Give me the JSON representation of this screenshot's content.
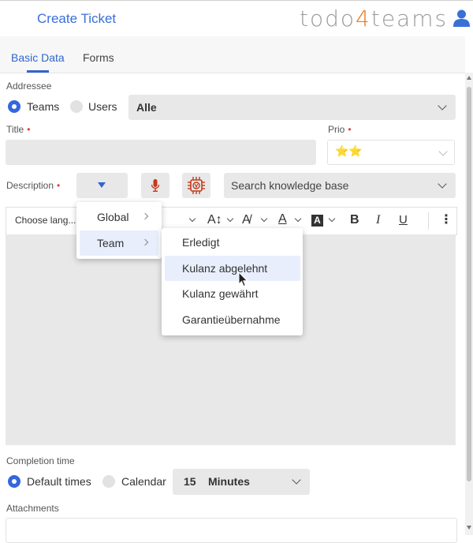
{
  "header": {
    "title": "Create Ticket",
    "logo_prefix": "todo",
    "logo_digit": "4",
    "logo_suffix": "teams",
    "accent_color": "#3a6fd8",
    "logo_digit_color": "#e87b1d"
  },
  "tabs": [
    {
      "label": "Basic Data",
      "active": true
    },
    {
      "label": "Forms",
      "active": false
    }
  ],
  "addressee": {
    "label": "Addressee",
    "options": [
      {
        "label": "Teams",
        "selected": true
      },
      {
        "label": "Users",
        "selected": false
      }
    ],
    "select_value": "Alle"
  },
  "title_field": {
    "label": "Title",
    "value": ""
  },
  "prio": {
    "label": "Prio",
    "value": "⭐⭐"
  },
  "description": {
    "label": "Description",
    "kb_placeholder": "Search knowledge base"
  },
  "editor": {
    "language_button": "Choose lang...",
    "toolbar_icons": [
      "font-size-icon",
      "text-style-icon",
      "font-color-icon",
      "highlight-icon",
      "bold-icon",
      "italic-icon",
      "underline-icon",
      "more-icon"
    ],
    "bold": "B",
    "italic": "I",
    "underline": "U"
  },
  "dropdown": {
    "items": [
      {
        "label": "Global"
      },
      {
        "label": "Team",
        "highlighted": true
      }
    ],
    "submenu": [
      {
        "label": "Erledigt"
      },
      {
        "label": "Kulanz abgelehnt",
        "highlighted": true
      },
      {
        "label": "Kulanz gewährt"
      },
      {
        "label": "Garantieübernahme"
      }
    ]
  },
  "completion": {
    "label": "Completion time",
    "options": [
      {
        "label": "Default times",
        "selected": true
      },
      {
        "label": "Calendar",
        "selected": false
      }
    ],
    "amount": "15",
    "unit": "Minutes"
  },
  "attachments": {
    "label": "Attachments"
  },
  "required_marker": "•"
}
